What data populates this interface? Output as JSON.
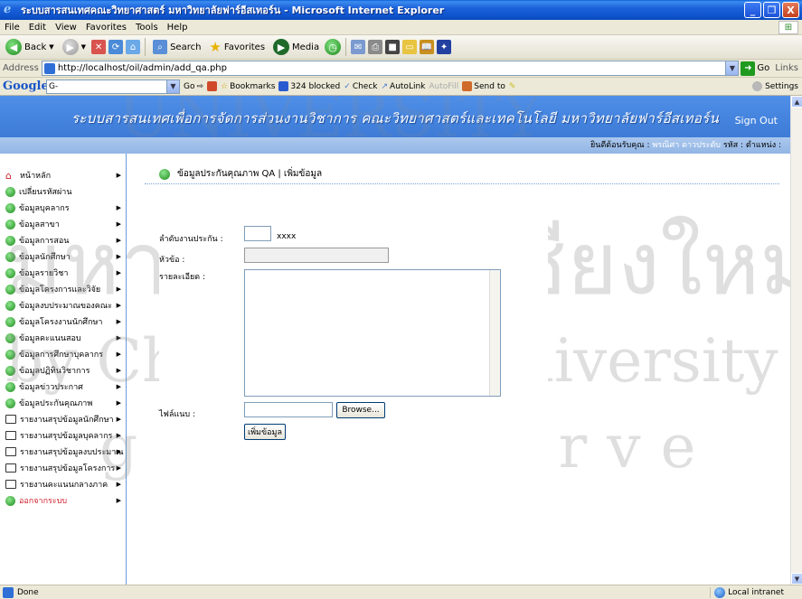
{
  "window": {
    "title": "ระบบสารสนเทศคณะวิทยาศาสตร์ มหาวิทยาลัยฟาร์อีสเทอร์น - Microsoft Internet Explorer",
    "buttons": [
      "_",
      "❐",
      "X"
    ]
  },
  "menu": [
    "File",
    "Edit",
    "View",
    "Favorites",
    "Tools",
    "Help"
  ],
  "toolbar": {
    "back": "Back",
    "search": "Search",
    "favorites": "Favorites",
    "media": "Media"
  },
  "address": {
    "label": "Address",
    "url": "http://localhost/oil/admin/add_qa.php",
    "go": "Go",
    "links": "Links"
  },
  "googlebar": {
    "logo": "Google",
    "search_value": "G-",
    "go": "Go",
    "bookmarks": "Bookmarks",
    "blocked": "324 blocked",
    "check": "Check",
    "autolink": "AutoLink",
    "autofill": "AutoFill",
    "sendto": "Send to",
    "settings": "Settings"
  },
  "page": {
    "site_title": "ระบบสารสนเทศเพื่อการจัดการส่วนงานวิชาการ คณะวิทยาศาสตร์และเทคโนโลยี มหาวิทยาลัยฟาร์อีสเทอร์น",
    "sign_out": "Sign Out",
    "welcome_prefix": "ยินดีต้อนรับคุณ :",
    "welcome_user": "พรณิศา ดาวประดับ",
    "welcome_role": "รหัส : ตำแหน่ง :",
    "breadcrumb": "ข้อมูลประกันคุณภาพ QA | เพิ่มข้อมูล"
  },
  "sidebar": {
    "items": [
      {
        "label": "หน้าหลัก",
        "icon": "home-icon",
        "caret": true
      },
      {
        "label": "เปลี่ยนรหัสผ่าน",
        "icon": "green-dot-icon",
        "caret": false
      },
      {
        "label": "ข้อมูลบุคลากร",
        "icon": "green-dot-icon",
        "caret": true
      },
      {
        "label": "ข้อมูลสาขา",
        "icon": "green-dot-icon",
        "caret": true
      },
      {
        "label": "ข้อมูลการสอน",
        "icon": "green-dot-icon",
        "caret": true
      },
      {
        "label": "ข้อมูลนักศึกษา",
        "icon": "green-dot-icon",
        "caret": true
      },
      {
        "label": "ข้อมูลรายวิชา",
        "icon": "green-dot-icon",
        "caret": true
      },
      {
        "label": "ข้อมูลโครงการและวิจัย",
        "icon": "green-dot-icon",
        "caret": true
      },
      {
        "label": "ข้อมูลงบประมาณของคณะ",
        "icon": "green-dot-icon",
        "caret": true
      },
      {
        "label": "ข้อมูลโครงงานนักศึกษา",
        "icon": "green-dot-icon",
        "caret": true
      },
      {
        "label": "ข้อมูลคะแนนสอบ",
        "icon": "green-dot-icon",
        "caret": true
      },
      {
        "label": "ข้อมูลการศึกษาบุคลากร",
        "icon": "green-dot-icon",
        "caret": true
      },
      {
        "label": "ข้อมูลปฏิทินวิชาการ",
        "icon": "green-dot-icon",
        "caret": true
      },
      {
        "label": "ข้อมูลข่าวประกาศ",
        "icon": "green-dot-icon",
        "caret": true
      },
      {
        "label": "ข้อมูลประกันคุณภาพ",
        "icon": "green-dot-icon",
        "caret": true
      },
      {
        "label": "รายงานสรุปข้อมูลนักศึกษา",
        "icon": "book-icon",
        "caret": true
      },
      {
        "label": "รายงานสรุปข้อมูลบุคลากร",
        "icon": "book-icon",
        "caret": true
      },
      {
        "label": "รายงานสรุปข้อมูลงบประมาณ",
        "icon": "book-icon",
        "caret": true
      },
      {
        "label": "รายงานสรุปข้อมูลโครงการ",
        "icon": "book-icon",
        "caret": true
      },
      {
        "label": "รายงานคะแนนกลางภาค",
        "icon": "book-icon",
        "caret": true
      },
      {
        "label": "ออกจากระบบ",
        "icon": "green-dot-icon",
        "caret": true
      }
    ]
  },
  "form": {
    "order_label": "ลำดับงานประกัน :",
    "order_hint": "xxxx",
    "subject_label": "หัวข้อ :",
    "detail_label": "รายละเอียด :",
    "attach_label": "ไฟล์แนบ :",
    "browse_label": "Browse...",
    "submit_label": "เพิ่มข้อมูล"
  },
  "watermark": {
    "line1": "มหาวิทยาลัยเชียงใหม่",
    "line2": "by Chiang Mai University",
    "line3": "ghts reserve",
    "arc": "UNIVERSITY"
  },
  "status": {
    "text": "Done",
    "zone": "Local intranet"
  }
}
